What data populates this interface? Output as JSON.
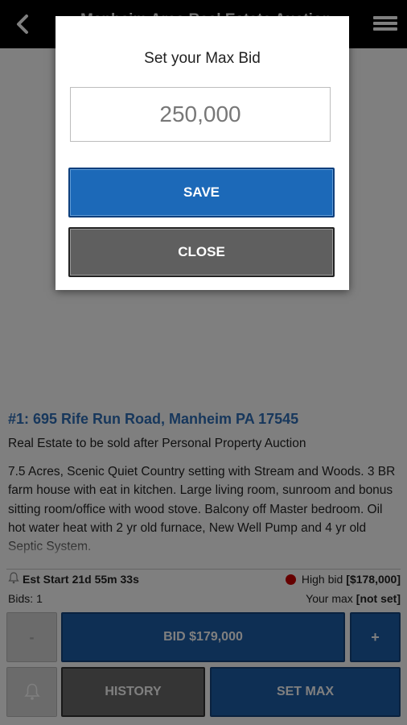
{
  "header": {
    "title": "Manheim Area Real Estate Auction",
    "back_icon": "chevron-left-icon",
    "menu_icon": "hamburger-menu-icon"
  },
  "lot": {
    "title": "#1: 695 Rife Run Road, Manheim PA 17545",
    "subtitle": "Real Estate to be sold after Personal Property Auction",
    "description": "7.5 Acres, Scenic Quiet Country setting with Stream and Woods. 3 BR farm house with eat in kitchen. Large living room, sunroom and bonus sitting room/office with wood stove. Balcony off Master bedroom. Oil hot water heat with 2 yr old furnace, New Well Pump and 4 yr old Septic System.",
    "est_start_label": "Est Start",
    "est_start_value": "21d 55m 33s",
    "high_bid_label": "High bid",
    "high_bid_value": "[$178,000]",
    "bids_label": "Bids:",
    "bids_count": "1",
    "your_max_label": "Your max",
    "your_max_value": "[not set]"
  },
  "actions": {
    "minus_label": "-",
    "bid_label": "BID $179,000",
    "plus_label": "+",
    "history_label": "HISTORY",
    "set_max_label": "SET MAX"
  },
  "dialog": {
    "title": "Set your Max Bid",
    "input_value": "250,000",
    "save_label": "SAVE",
    "close_label": "CLOSE"
  },
  "colors": {
    "accent_blue": "#1d5ea8",
    "title_blue": "#2f6fb8",
    "high_bid_dot": "#cc0000",
    "history_gray": "#6b6b6b"
  }
}
